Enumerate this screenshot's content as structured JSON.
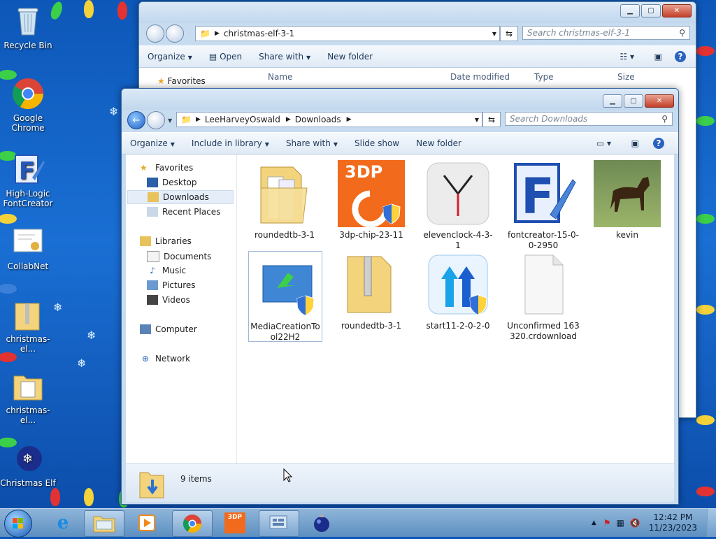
{
  "desktop": {
    "icons": [
      {
        "label": "Recycle Bin"
      },
      {
        "label": "Google Chrome"
      },
      {
        "label": "High-Logic FontCreator"
      },
      {
        "label": "CollabNet"
      },
      {
        "label": "christmas-el..."
      },
      {
        "label": "christmas-el..."
      },
      {
        "label": "Christmas Elf"
      }
    ]
  },
  "back_window": {
    "address": [
      "christmas-elf-3-1"
    ],
    "search_placeholder": "Search christmas-elf-3-1",
    "toolbar": {
      "organize": "Organize",
      "open": "Open",
      "share": "Share with",
      "new_folder": "New folder"
    },
    "nav_favorites": "Favorites",
    "columns": {
      "name": "Name",
      "date": "Date modified",
      "type": "Type",
      "size": "Size"
    }
  },
  "front_window": {
    "address": [
      "LeeHarveyOswald",
      "Downloads"
    ],
    "search_placeholder": "Search Downloads",
    "toolbar": {
      "organize": "Organize",
      "include": "Include in library",
      "share": "Share with",
      "slideshow": "Slide show",
      "new_folder": "New folder"
    },
    "nav": {
      "favorites": "Favorites",
      "desktop": "Desktop",
      "downloads": "Downloads",
      "recent": "Recent Places",
      "libraries": "Libraries",
      "documents": "Documents",
      "music": "Music",
      "pictures": "Pictures",
      "videos": "Videos",
      "computer": "Computer",
      "network": "Network"
    },
    "files": [
      {
        "name": "roundedtb-3-1"
      },
      {
        "name": "3dp-chip-23-11",
        "thumb_text": "3DP"
      },
      {
        "name": "elevenclock-4-3-1"
      },
      {
        "name": "fontcreator-15-0-0-2950",
        "thumb_text": "F"
      },
      {
        "name": "kevin"
      },
      {
        "name": "MediaCreationTool22H2"
      },
      {
        "name": "roundedtb-3-1"
      },
      {
        "name": "start11-2-0-2-0"
      },
      {
        "name": "Unconfirmed 163320.crdownload"
      }
    ],
    "status": "9 items"
  },
  "taskbar": {
    "time": "12:42 PM",
    "date": "11/23/2023"
  }
}
